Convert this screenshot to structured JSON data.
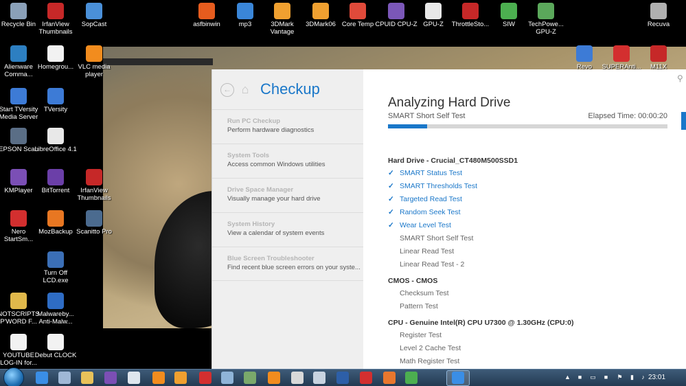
{
  "desktop": {
    "icons": [
      {
        "label": "Recycle Bin",
        "icon": "recycle-bin-icon",
        "color": "#8aa0b8"
      },
      {
        "label": "IrfanView Thumbnails",
        "icon": "irfanview-icon",
        "color": "#c62828"
      },
      {
        "label": "SopCast",
        "icon": "sopcast-icon",
        "color": "#4a90d9"
      },
      {
        "label": "Alienware Comma...",
        "icon": "alienware-icon",
        "color": "#2d7fc1"
      },
      {
        "label": "Homegrou...",
        "icon": "document-icon",
        "color": "#f2f2f2"
      },
      {
        "label": "VLC media player",
        "icon": "vlc-icon",
        "color": "#f28c1e"
      },
      {
        "label": "Start TVersity Media Server",
        "icon": "tversity-icon",
        "color": "#3d7bd6"
      },
      {
        "label": "TVersity",
        "icon": "tversity-icon",
        "color": "#3d7bd6"
      },
      {
        "label": "EPSON Scan",
        "icon": "scanner-icon",
        "color": "#5a6e86"
      },
      {
        "label": "LibreOffice 4.1",
        "icon": "libreoffice-icon",
        "color": "#e8e8e8"
      },
      {
        "label": "KMPlayer",
        "icon": "kmplayer-icon",
        "color": "#7b4fb5"
      },
      {
        "label": "BitTorrent",
        "icon": "bittorrent-icon",
        "color": "#6b3fa8"
      },
      {
        "label": "IrfanView Thumbnails",
        "icon": "irfanview-icon",
        "color": "#c62828"
      },
      {
        "label": "Nero StartSm...",
        "icon": "nero-icon",
        "color": "#d32f2f"
      },
      {
        "label": "MozBackup",
        "icon": "mozbackup-icon",
        "color": "#e87722"
      },
      {
        "label": "Scanitto Pro",
        "icon": "scanner-icon",
        "color": "#4b6b8f"
      },
      {
        "label": "Turn Off LCD.exe",
        "icon": "monitor-icon",
        "color": "#3b6fb6"
      },
      {
        "label": "NOTSCRIPTS P'WORD F...",
        "icon": "folder-icon",
        "color": "#e0b84b"
      },
      {
        "label": "Malwareby... Anti-Malw...",
        "icon": "malwarebytes-icon",
        "color": "#2e6cc4"
      },
      {
        "label": "YOUTUBE LOG-IN for...",
        "icon": "document-icon",
        "color": "#f2f2f2"
      },
      {
        "label": "Debut CLOCK",
        "icon": "document-icon",
        "color": "#f2f2f2"
      },
      {
        "label": "asfbinwin",
        "icon": "asf-icon",
        "color": "#e65c1e"
      },
      {
        "label": "mp3",
        "icon": "mp3-icon",
        "color": "#3a86d8"
      },
      {
        "label": "3DMark Vantage",
        "icon": "3dmark-icon",
        "color": "#f0a030"
      },
      {
        "label": "3DMark06",
        "icon": "3dmark-icon",
        "color": "#f0a030"
      },
      {
        "label": "Core Temp",
        "icon": "core-temp-icon",
        "color": "#e04a3a"
      },
      {
        "label": "CPUID CPU-Z",
        "icon": "cpuz-icon",
        "color": "#7b57b8"
      },
      {
        "label": "GPU-Z",
        "icon": "gpuz-icon",
        "color": "#e8e8e8"
      },
      {
        "label": "ThrottleSto...",
        "icon": "throttlestop-icon",
        "color": "#c62828"
      },
      {
        "label": "SIW",
        "icon": "siw-icon",
        "color": "#4caf50"
      },
      {
        "label": "TechPowe... GPU-Z",
        "icon": "gpuz-icon",
        "color": "#5ba85b"
      },
      {
        "label": "Recuva",
        "icon": "recuva-icon",
        "color": "#b0b0b0"
      },
      {
        "label": "Revo",
        "icon": "revo-icon",
        "color": "#3d7bd6"
      },
      {
        "label": "SUPERAnti...",
        "icon": "superantispyware-icon",
        "color": "#d32f2f"
      },
      {
        "label": "M11X",
        "icon": "pdf-icon",
        "color": "#c62828"
      }
    ]
  },
  "checkup": {
    "title": "Checkup",
    "nav": [
      {
        "title": "Run PC Checkup",
        "desc": "Perform hardware diagnostics"
      },
      {
        "title": "System Tools",
        "desc": "Access common Windows utilities"
      },
      {
        "title": "Drive Space Manager",
        "desc": "Visually manage your hard drive"
      },
      {
        "title": "System History",
        "desc": "View a calendar of system events"
      },
      {
        "title": "Blue Screen Troubleshooter",
        "desc": "Find recent blue screen errors on your syste..."
      }
    ],
    "main": {
      "title": "Analyzing Hard Drive",
      "current_test": "SMART Short Self Test",
      "elapsed": "Elapsed Time: 00:00:20",
      "progress": 0.14,
      "groups": [
        {
          "name": "Hard Drive - Crucial_CT480M500SSD1",
          "tests": [
            {
              "name": "SMART Status Test",
              "done": true
            },
            {
              "name": "SMART Thresholds Test",
              "done": true
            },
            {
              "name": "Targeted Read Test",
              "done": true
            },
            {
              "name": "Random Seek Test",
              "done": true
            },
            {
              "name": "Wear Level Test",
              "done": true
            },
            {
              "name": "SMART Short Self Test",
              "done": false
            },
            {
              "name": "Linear Read Test",
              "done": false
            },
            {
              "name": "Linear Read Test - 2",
              "done": false
            }
          ]
        },
        {
          "name": "CMOS - CMOS",
          "tests": [
            {
              "name": "Checksum Test",
              "done": false
            },
            {
              "name": "Pattern Test",
              "done": false
            }
          ]
        },
        {
          "name": "CPU - Genuine Intel(R) CPU U7300 @ 1.30GHz (CPU:0)",
          "tests": [
            {
              "name": "Register Test",
              "done": false
            },
            {
              "name": "Level 2 Cache Test",
              "done": false
            },
            {
              "name": "Math Register Test",
              "done": false
            }
          ]
        }
      ],
      "check_glyph": "✓"
    }
  },
  "taskbar": {
    "clock": "23:01",
    "apps": [
      {
        "icon": "ie-icon",
        "color": "#3a8ee6"
      },
      {
        "icon": "document-icon",
        "color": "#9fb8d6"
      },
      {
        "icon": "explorer-icon",
        "color": "#e8c25a"
      },
      {
        "icon": "kmplayer-icon",
        "color": "#7b4fb5"
      },
      {
        "icon": "disc-icon",
        "color": "#dfe6ee"
      },
      {
        "icon": "vlc-icon",
        "color": "#f28c1e"
      },
      {
        "icon": "media-icon",
        "color": "#f0a030"
      },
      {
        "icon": "tools-icon",
        "color": "#d32f2f"
      },
      {
        "icon": "settings-icon",
        "color": "#8fb4d8"
      },
      {
        "icon": "download-icon",
        "color": "#7aa96b"
      },
      {
        "icon": "vlc-icon",
        "color": "#f28c1e"
      },
      {
        "icon": "shield-icon",
        "color": "#d9d9d9"
      },
      {
        "icon": "save-icon",
        "color": "#c8d3e0"
      },
      {
        "icon": "globe-icon",
        "color": "#2d5fa8"
      },
      {
        "icon": "opera-icon",
        "color": "#d32f2f"
      },
      {
        "icon": "firefox-icon",
        "color": "#e8772e"
      },
      {
        "icon": "chrome-icon",
        "color": "#4caf50"
      },
      {
        "icon": "checkup-icon",
        "color": "#3a8ee6"
      }
    ],
    "tray": [
      {
        "icon": "chevron-up-icon"
      },
      {
        "icon": "app-tray-icon"
      },
      {
        "icon": "monitor-icon"
      },
      {
        "icon": "shield-tray-icon"
      },
      {
        "icon": "flag-icon"
      },
      {
        "icon": "signal-icon"
      },
      {
        "icon": "volume-icon"
      }
    ]
  }
}
